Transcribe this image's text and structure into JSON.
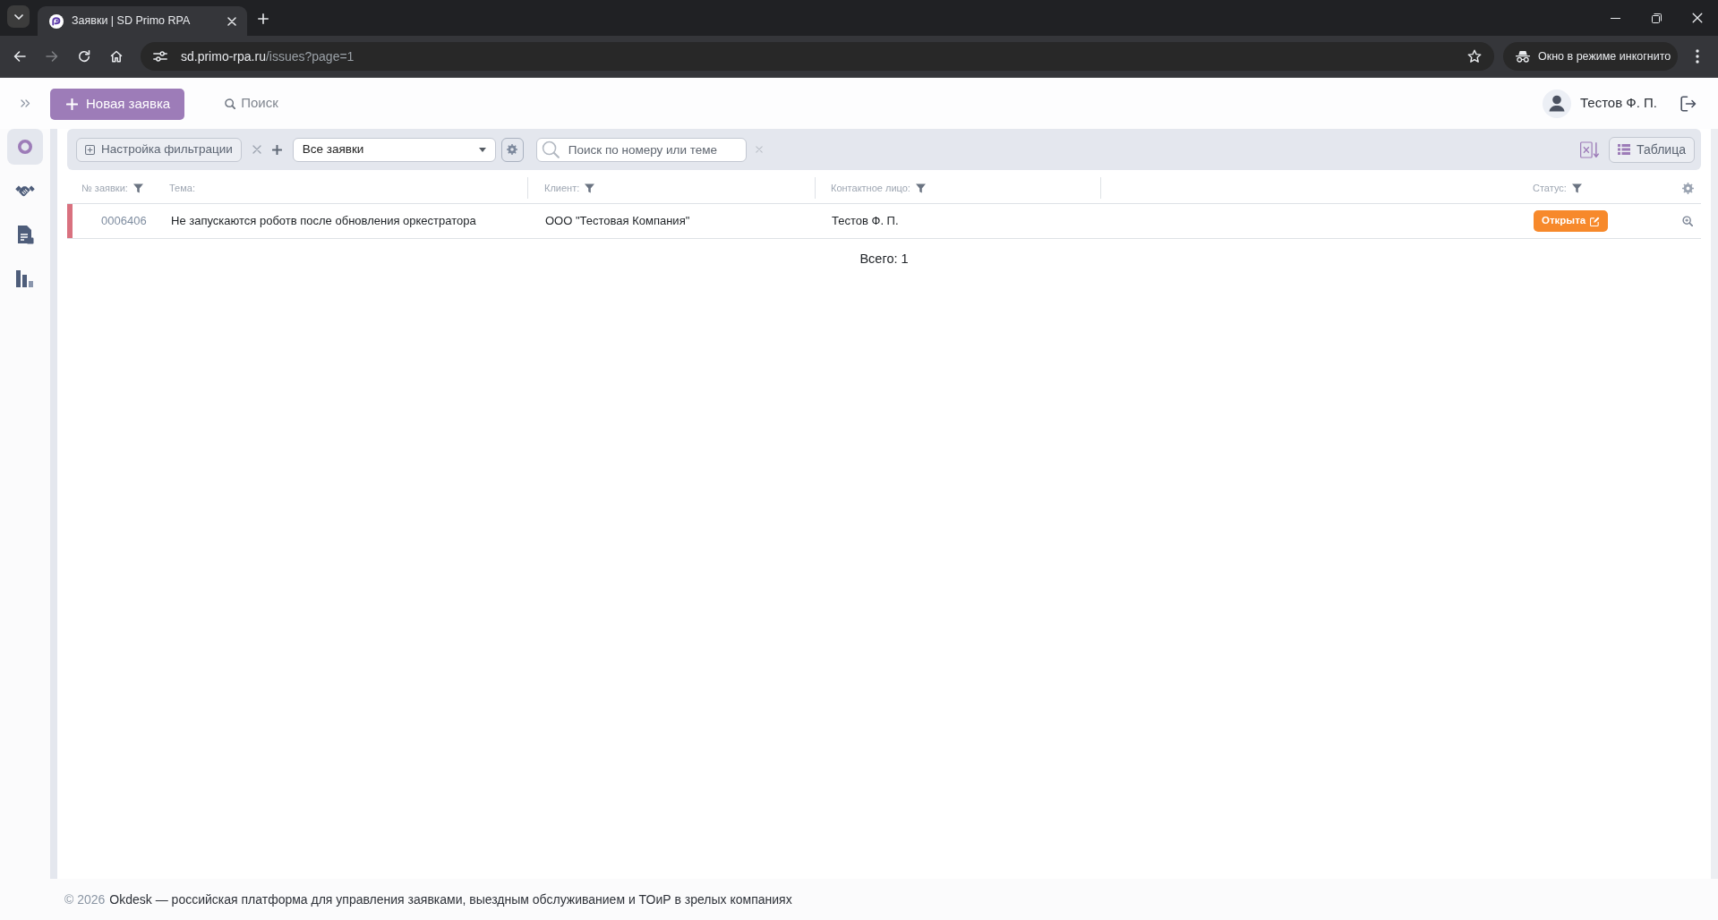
{
  "browser": {
    "tab": {
      "title": "Заявки | SD Primo RPA"
    },
    "url": {
      "host": "sd.primo-rpa.ru",
      "path": "/issues?page=1"
    },
    "incognito_label": "Окно в режиме инкогнито"
  },
  "header": {
    "new_issue_button": "Новая заявка",
    "search_button": "Поиск",
    "user_name": "Тестов Ф. П."
  },
  "sidebar": {
    "items": [
      {
        "kind": "issues",
        "selected": true
      },
      {
        "kind": "clients",
        "selected": false
      },
      {
        "kind": "documents",
        "selected": false
      },
      {
        "kind": "reports",
        "selected": false
      }
    ]
  },
  "filter_bar": {
    "filter_settings_button": "Настройка фильтрации",
    "view_select": "Все заявки",
    "search": {
      "placeholder": "Поиск по номеру или теме"
    },
    "view_mode_button": "Таблица"
  },
  "table": {
    "columns": [
      {
        "label": "№ заявки:",
        "filter": true
      },
      {
        "label": "Тема:",
        "filter": false
      },
      {
        "label": "Клиент:",
        "filter": true
      },
      {
        "label": "Контактное лицо:",
        "filter": true
      },
      {
        "label": "Статус:",
        "filter": true
      }
    ],
    "rows": [
      {
        "color": "#d9717f",
        "number": "0006406",
        "topic": "Не запускаются роботв после обновления оркестратора",
        "client": "ООО \"Тестовая Компания\"",
        "contact": "Тестов Ф. П.",
        "status": {
          "label": "Открыта",
          "color": "#f7892b"
        }
      }
    ]
  },
  "total": "Всего: 1",
  "footer": {
    "copyright": "© 2026",
    "tagline": "Okdesk — российская платформа для управления заявками, выездным обслуживанием и ТОиР в зрелых компаниях"
  }
}
